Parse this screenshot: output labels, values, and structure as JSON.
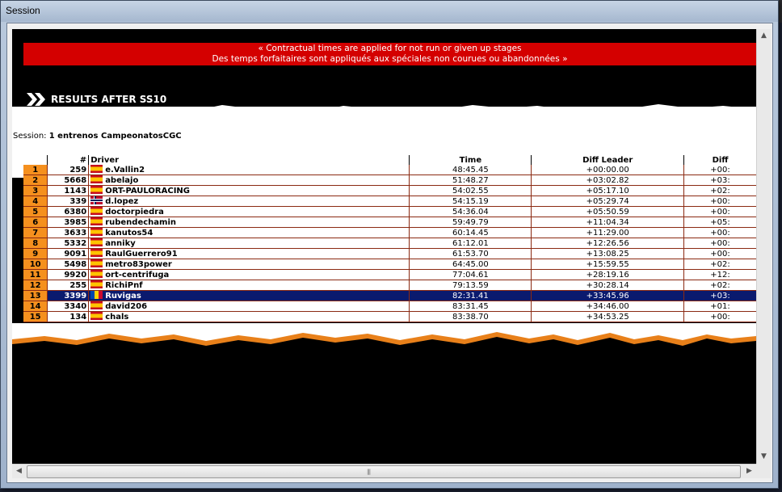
{
  "window": {
    "title": "Session"
  },
  "banner": {
    "line1": "« Contractual times are applied for not run or given up stages",
    "line2": "Des temps forfaitaires sont appliqués aux spéciales non courues ou abandonnées »"
  },
  "results": {
    "title": "RESULTS AFTER SS10",
    "session_label": "Session:",
    "session_value": "1 entrenos CampeonatosCGC"
  },
  "table": {
    "headers": {
      "pos": "",
      "num": "#",
      "driver": "Driver",
      "time": "Time",
      "diff_leader": "Diff Leader",
      "diff": "Diff"
    },
    "rows": [
      {
        "pos": "1",
        "num": "259",
        "flag": "spain-flag-icon",
        "driver": "e.Vallin2",
        "time": "48:45.45",
        "diff_leader": "+00:00.00",
        "diff": "+00:"
      },
      {
        "pos": "2",
        "num": "5668",
        "flag": "spain-flag-icon",
        "driver": "abelajo",
        "time": "51:48.27",
        "diff_leader": "+03:02.82",
        "diff": "+03:"
      },
      {
        "pos": "3",
        "num": "1143",
        "flag": "spain-flag-icon",
        "driver": "ORT-PAULORACING",
        "time": "54:02.55",
        "diff_leader": "+05:17.10",
        "diff": "+02:"
      },
      {
        "pos": "4",
        "num": "339",
        "flag": "norway-flag-icon",
        "driver": "d.lopez",
        "time": "54:15.19",
        "diff_leader": "+05:29.74",
        "diff": "+00:"
      },
      {
        "pos": "5",
        "num": "6380",
        "flag": "spain-flag-icon",
        "driver": "doctorpiedra",
        "time": "54:36.04",
        "diff_leader": "+05:50.59",
        "diff": "+00:"
      },
      {
        "pos": "6",
        "num": "3985",
        "flag": "spain-flag-icon",
        "driver": "rubendechamin",
        "time": "59:49.79",
        "diff_leader": "+11:04.34",
        "diff": "+05:"
      },
      {
        "pos": "7",
        "num": "3633",
        "flag": "spain-flag-icon",
        "driver": "kanutos54",
        "time": "60:14.45",
        "diff_leader": "+11:29.00",
        "diff": "+00:"
      },
      {
        "pos": "8",
        "num": "5332",
        "flag": "spain-flag-icon",
        "driver": "anniky",
        "time": "61:12.01",
        "diff_leader": "+12:26.56",
        "diff": "+00:"
      },
      {
        "pos": "9",
        "num": "9091",
        "flag": "spain-flag-icon",
        "driver": "RaulGuerrero91",
        "time": "61:53.70",
        "diff_leader": "+13:08.25",
        "diff": "+00:"
      },
      {
        "pos": "10",
        "num": "5498",
        "flag": "spain-flag-icon",
        "driver": "metro83power",
        "time": "64:45.00",
        "diff_leader": "+15:59.55",
        "diff": "+02:"
      },
      {
        "pos": "11",
        "num": "9920",
        "flag": "spain-flag-icon",
        "driver": "ort-centrifuga",
        "time": "77:04.61",
        "diff_leader": "+28:19.16",
        "diff": "+12:"
      },
      {
        "pos": "12",
        "num": "255",
        "flag": "spain-flag-icon",
        "driver": "RichiPnf",
        "time": "79:13.59",
        "diff_leader": "+30:28.14",
        "diff": "+02:"
      },
      {
        "pos": "13",
        "num": "3399",
        "flag": "moldova-flag-icon",
        "driver": "Ruvigas",
        "time": "82:31.41",
        "diff_leader": "+33:45.96",
        "diff": "+03:",
        "highlighted": true
      },
      {
        "pos": "14",
        "num": "3340",
        "flag": "spain-flag-icon",
        "driver": "david206",
        "time": "83:31.45",
        "diff_leader": "+34:46.00",
        "diff": "+01:"
      },
      {
        "pos": "15",
        "num": "134",
        "flag": "spain-flag-icon",
        "driver": "chals",
        "time": "83:38.70",
        "diff_leader": "+34:53.25",
        "diff": "+00:"
      }
    ]
  },
  "colors": {
    "banner": "#d40000",
    "position_cell": "#f5901e",
    "highlight_row": "#0a1a6e",
    "torn_edge": "#e8801a"
  }
}
